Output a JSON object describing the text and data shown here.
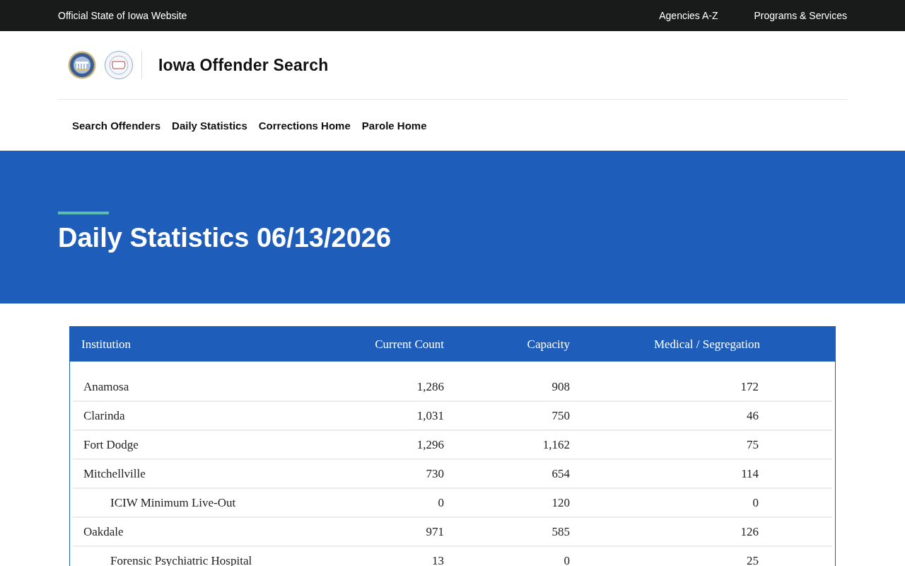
{
  "top_bar": {
    "site_label": "Official State of Iowa Website",
    "links": [
      "Agencies A-Z",
      "Programs & Services"
    ]
  },
  "header": {
    "title": "Iowa Offender Search"
  },
  "nav": {
    "items": [
      "Search Offenders",
      "Daily Statistics",
      "Corrections Home",
      "Parole Home"
    ]
  },
  "hero": {
    "title": "Daily Statistics 06/13/2026"
  },
  "table": {
    "columns": [
      "Institution",
      "Current Count",
      "Capacity",
      "Medical / Segregation"
    ],
    "rows": [
      {
        "institution": "Anamosa",
        "current_count": "1,286",
        "capacity": "908",
        "medical_segregation": "172"
      },
      {
        "institution": "Clarinda",
        "current_count": "1,031",
        "capacity": "750",
        "medical_segregation": "46"
      },
      {
        "institution": "Fort Dodge",
        "current_count": "1,296",
        "capacity": "1,162",
        "medical_segregation": "75"
      },
      {
        "institution": "Mitchellville",
        "current_count": "730",
        "capacity": "654",
        "medical_segregation": "114",
        "children": [
          {
            "institution": "ICIW Minimum Live-Out",
            "current_count": "0",
            "capacity": "120",
            "medical_segregation": "0"
          }
        ]
      },
      {
        "institution": "Oakdale",
        "current_count": "971",
        "capacity": "585",
        "medical_segregation": "126",
        "children": [
          {
            "institution": "Forensic Psychiatric Hospital",
            "current_count": "13",
            "capacity": "0",
            "medical_segregation": "25"
          }
        ]
      }
    ]
  }
}
